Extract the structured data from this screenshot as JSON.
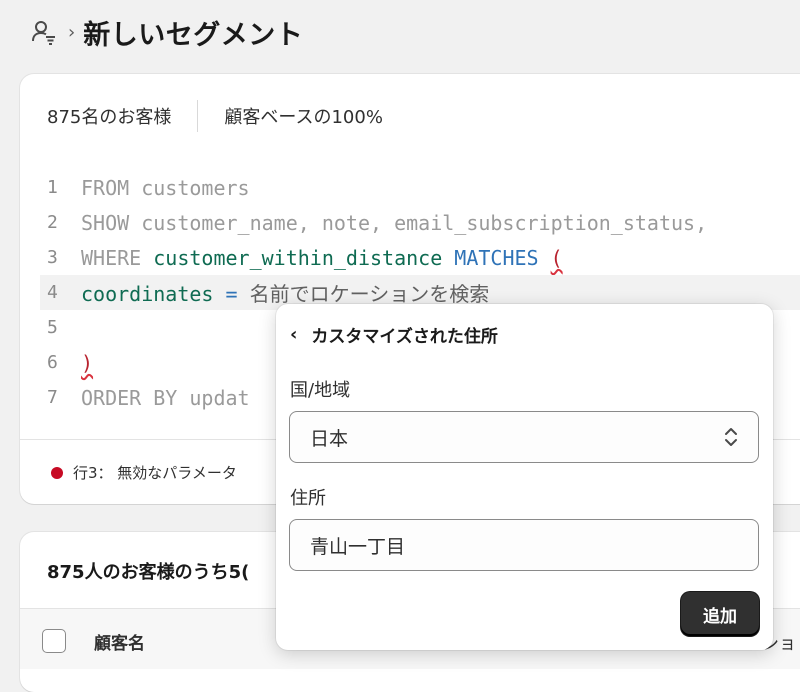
{
  "header": {
    "title": "新しいセグメント",
    "icon": "customer-segment-icon",
    "chevron": "›"
  },
  "stats": {
    "count_text": "875名のお客様",
    "percent_text": "顧客ベースの100%"
  },
  "editor": {
    "lines": [
      {
        "n": "1",
        "parts": [
          {
            "t": "FROM customers",
            "c": "kw"
          }
        ]
      },
      {
        "n": "2",
        "parts": [
          {
            "t": "SHOW customer_name, note, email_subscription_status,",
            "c": "kw"
          }
        ]
      },
      {
        "n": "3",
        "parts": [
          {
            "t": "WHERE ",
            "c": "kw"
          },
          {
            "t": "customer_within_distance ",
            "c": "fn"
          },
          {
            "t": "MATCHES ",
            "c": "op"
          },
          {
            "t": "(",
            "c": "paren"
          }
        ]
      },
      {
        "n": "4",
        "parts": [
          {
            "t": "coordinates ",
            "c": "fn"
          },
          {
            "t": "= ",
            "c": "op"
          },
          {
            "t": "名前でロケーションを検索",
            "c": "txt"
          }
        ]
      },
      {
        "n": "5",
        "parts": []
      },
      {
        "n": "6",
        "parts": [
          {
            "t": ")",
            "c": "paren"
          }
        ]
      },
      {
        "n": "7",
        "parts": [
          {
            "t": "ORDER BY updat",
            "c": "kw"
          }
        ]
      }
    ]
  },
  "error": {
    "text": "行3： 無効なパラメータ"
  },
  "results": {
    "title": "875人のお客様のうち5(",
    "col_name": "顧客名",
    "col_trail": "ショ"
  },
  "popover": {
    "back": "‹",
    "title": "カスタマイズされた住所",
    "country_label": "国/地域",
    "country_value": "日本",
    "address_label": "住所",
    "address_value": "青山一丁目",
    "add_label": "追加"
  },
  "colors": {
    "error": "#c70a24",
    "primary_button": "#303030",
    "code_function": "#0f6b52",
    "code_operator": "#2f73b7"
  }
}
